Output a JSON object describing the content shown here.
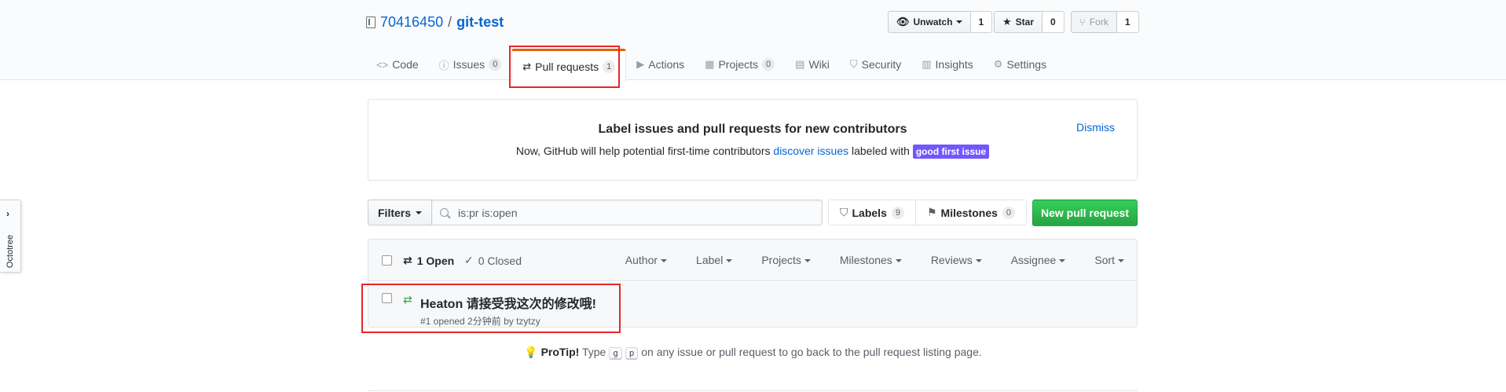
{
  "repo": {
    "owner": "70416450",
    "separator": "/",
    "name": "git-test"
  },
  "actions": {
    "watch_label": "Unwatch",
    "watch_count": "1",
    "star_label": "Star",
    "star_count": "0",
    "fork_label": "Fork",
    "fork_count": "1"
  },
  "tabs": [
    {
      "label": "Code",
      "icon": "code-icon"
    },
    {
      "label": "Issues",
      "count": "0",
      "icon": "issue-icon"
    },
    {
      "label": "Pull requests",
      "count": "1",
      "icon": "pull-request-icon",
      "selected": true
    },
    {
      "label": "Actions",
      "icon": "play-icon"
    },
    {
      "label": "Projects",
      "count": "0",
      "icon": "project-icon"
    },
    {
      "label": "Wiki",
      "icon": "book-icon"
    },
    {
      "label": "Security",
      "icon": "shield-icon"
    },
    {
      "label": "Insights",
      "icon": "graph-icon"
    },
    {
      "label": "Settings",
      "icon": "gear-icon"
    }
  ],
  "octotree": {
    "label": "Octotree"
  },
  "banner": {
    "title": "Label issues and pull requests for new contributors",
    "text_before": "Now, GitHub will help potential first-time contributors ",
    "link": "discover issues",
    "text_after": " labeled with ",
    "label": "good first issue",
    "dismiss": "Dismiss"
  },
  "filters": {
    "button": "Filters",
    "query": "is:pr is:open",
    "labels_label": "Labels",
    "labels_count": "9",
    "milestones_label": "Milestones",
    "milestones_count": "0",
    "new_pr": "New pull request"
  },
  "list_header": {
    "open": "1 Open",
    "closed": "0 Closed",
    "author": "Author",
    "label": "Label",
    "projects": "Projects",
    "milestones": "Milestones",
    "reviews": "Reviews",
    "assignee": "Assignee",
    "sort": "Sort"
  },
  "pull_requests": [
    {
      "title": "Heaton 请接受我这次的修改哦!",
      "meta": "#1 opened 2分钟前 by tzytzy"
    }
  ],
  "protip": {
    "lead": "ProTip!",
    "text_1": " Type ",
    "key_1": "g",
    "key_2": "p",
    "text_2": " on any issue or pull request to go back to the pull request listing page."
  },
  "colors": {
    "accent_link": "#0366d6",
    "green_button": "#28a745",
    "label_purple": "#7057ff",
    "annotation_red": "#e8262a",
    "selected_tab_top": "#e36209"
  }
}
